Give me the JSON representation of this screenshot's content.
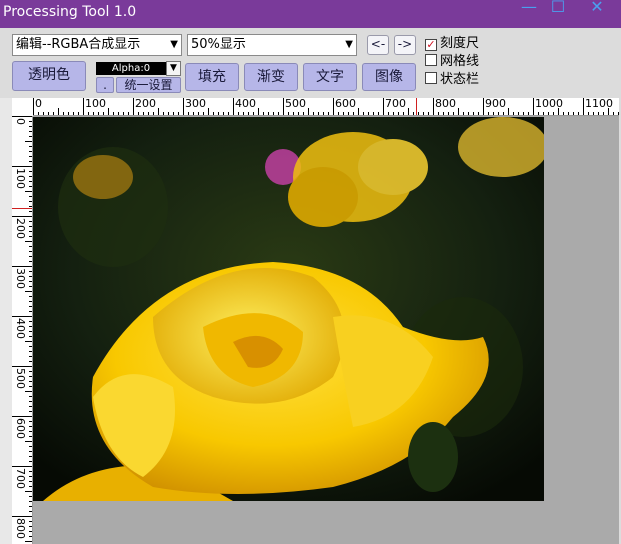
{
  "window": {
    "title": "Processing Tool 1.0",
    "minimize_icon": "minimize-icon",
    "maximize_icon": "maximize-icon",
    "close_icon": "close-icon",
    "title_color": "#7a3a9a"
  },
  "toolbar": {
    "mode_select": "编辑--RGBA合成显示",
    "zoom_select": "50%显示",
    "prev_label": "<-",
    "next_label": "->",
    "transparent_label": "透明色",
    "alpha_value": "Alpha:0",
    "dot_label": ".",
    "uniform_set_label": "统一设置",
    "fill_label": "填充",
    "gradient_label": "渐变",
    "text_label": "文字",
    "image_label": "图像"
  },
  "options": [
    {
      "label": "刻度尺",
      "checked": true
    },
    {
      "label": "网格线",
      "checked": false
    },
    {
      "label": "状态栏",
      "checked": false
    }
  ],
  "ruler": {
    "h_labels": [
      "0",
      "100",
      "200",
      "300",
      "400",
      "500",
      "600",
      "700",
      "800",
      "900",
      "1000",
      "1100"
    ],
    "v_labels": [
      "0",
      "100",
      "200",
      "300",
      "400",
      "500",
      "600",
      "700",
      "800"
    ]
  },
  "canvas": {
    "image_description_icon": "yellow-rose-photo"
  }
}
